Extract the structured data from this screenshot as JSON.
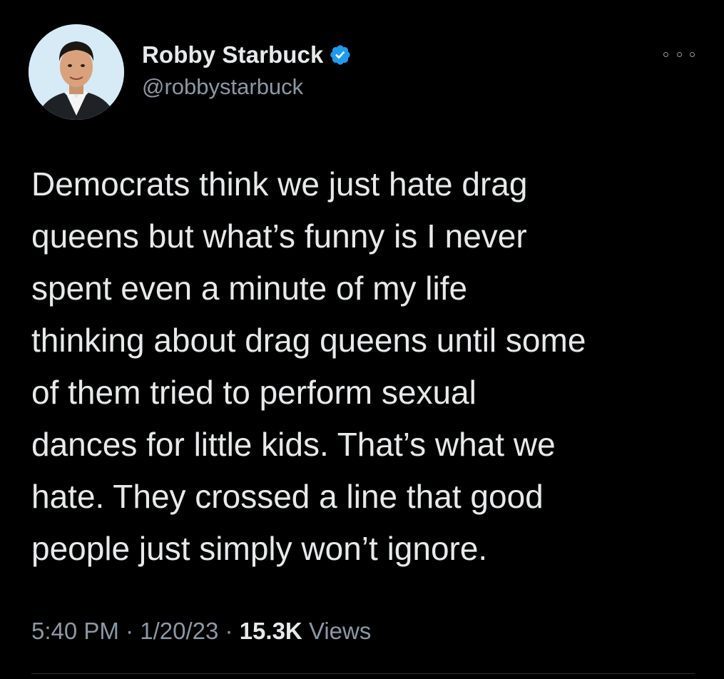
{
  "author": {
    "display_name": "Robby Starbuck",
    "handle": "@robbystarbuck",
    "verified": true,
    "verified_color": "#1d9bf0"
  },
  "tweet": {
    "text_lines": [
      "Democrats think we just hate drag",
      "queens but what’s funny is I never",
      "spent even a minute of my life",
      "thinking about drag queens until some",
      "of them tried to perform sexual",
      "dances for little kids. That’s what we",
      "hate. They crossed a line that good",
      "people just simply won’t ignore."
    ]
  },
  "meta": {
    "time": "5:40 PM",
    "date": "1/20/23",
    "separator": "·",
    "views_count": "15.3K",
    "views_label": "Views"
  },
  "icons": {
    "more": "more-options-icon",
    "verified": "verified-badge-icon"
  },
  "colors": {
    "background": "#000000",
    "primary_text": "#e7e9ea",
    "secondary_text": "#8b98a5",
    "divider": "#2f3336"
  }
}
